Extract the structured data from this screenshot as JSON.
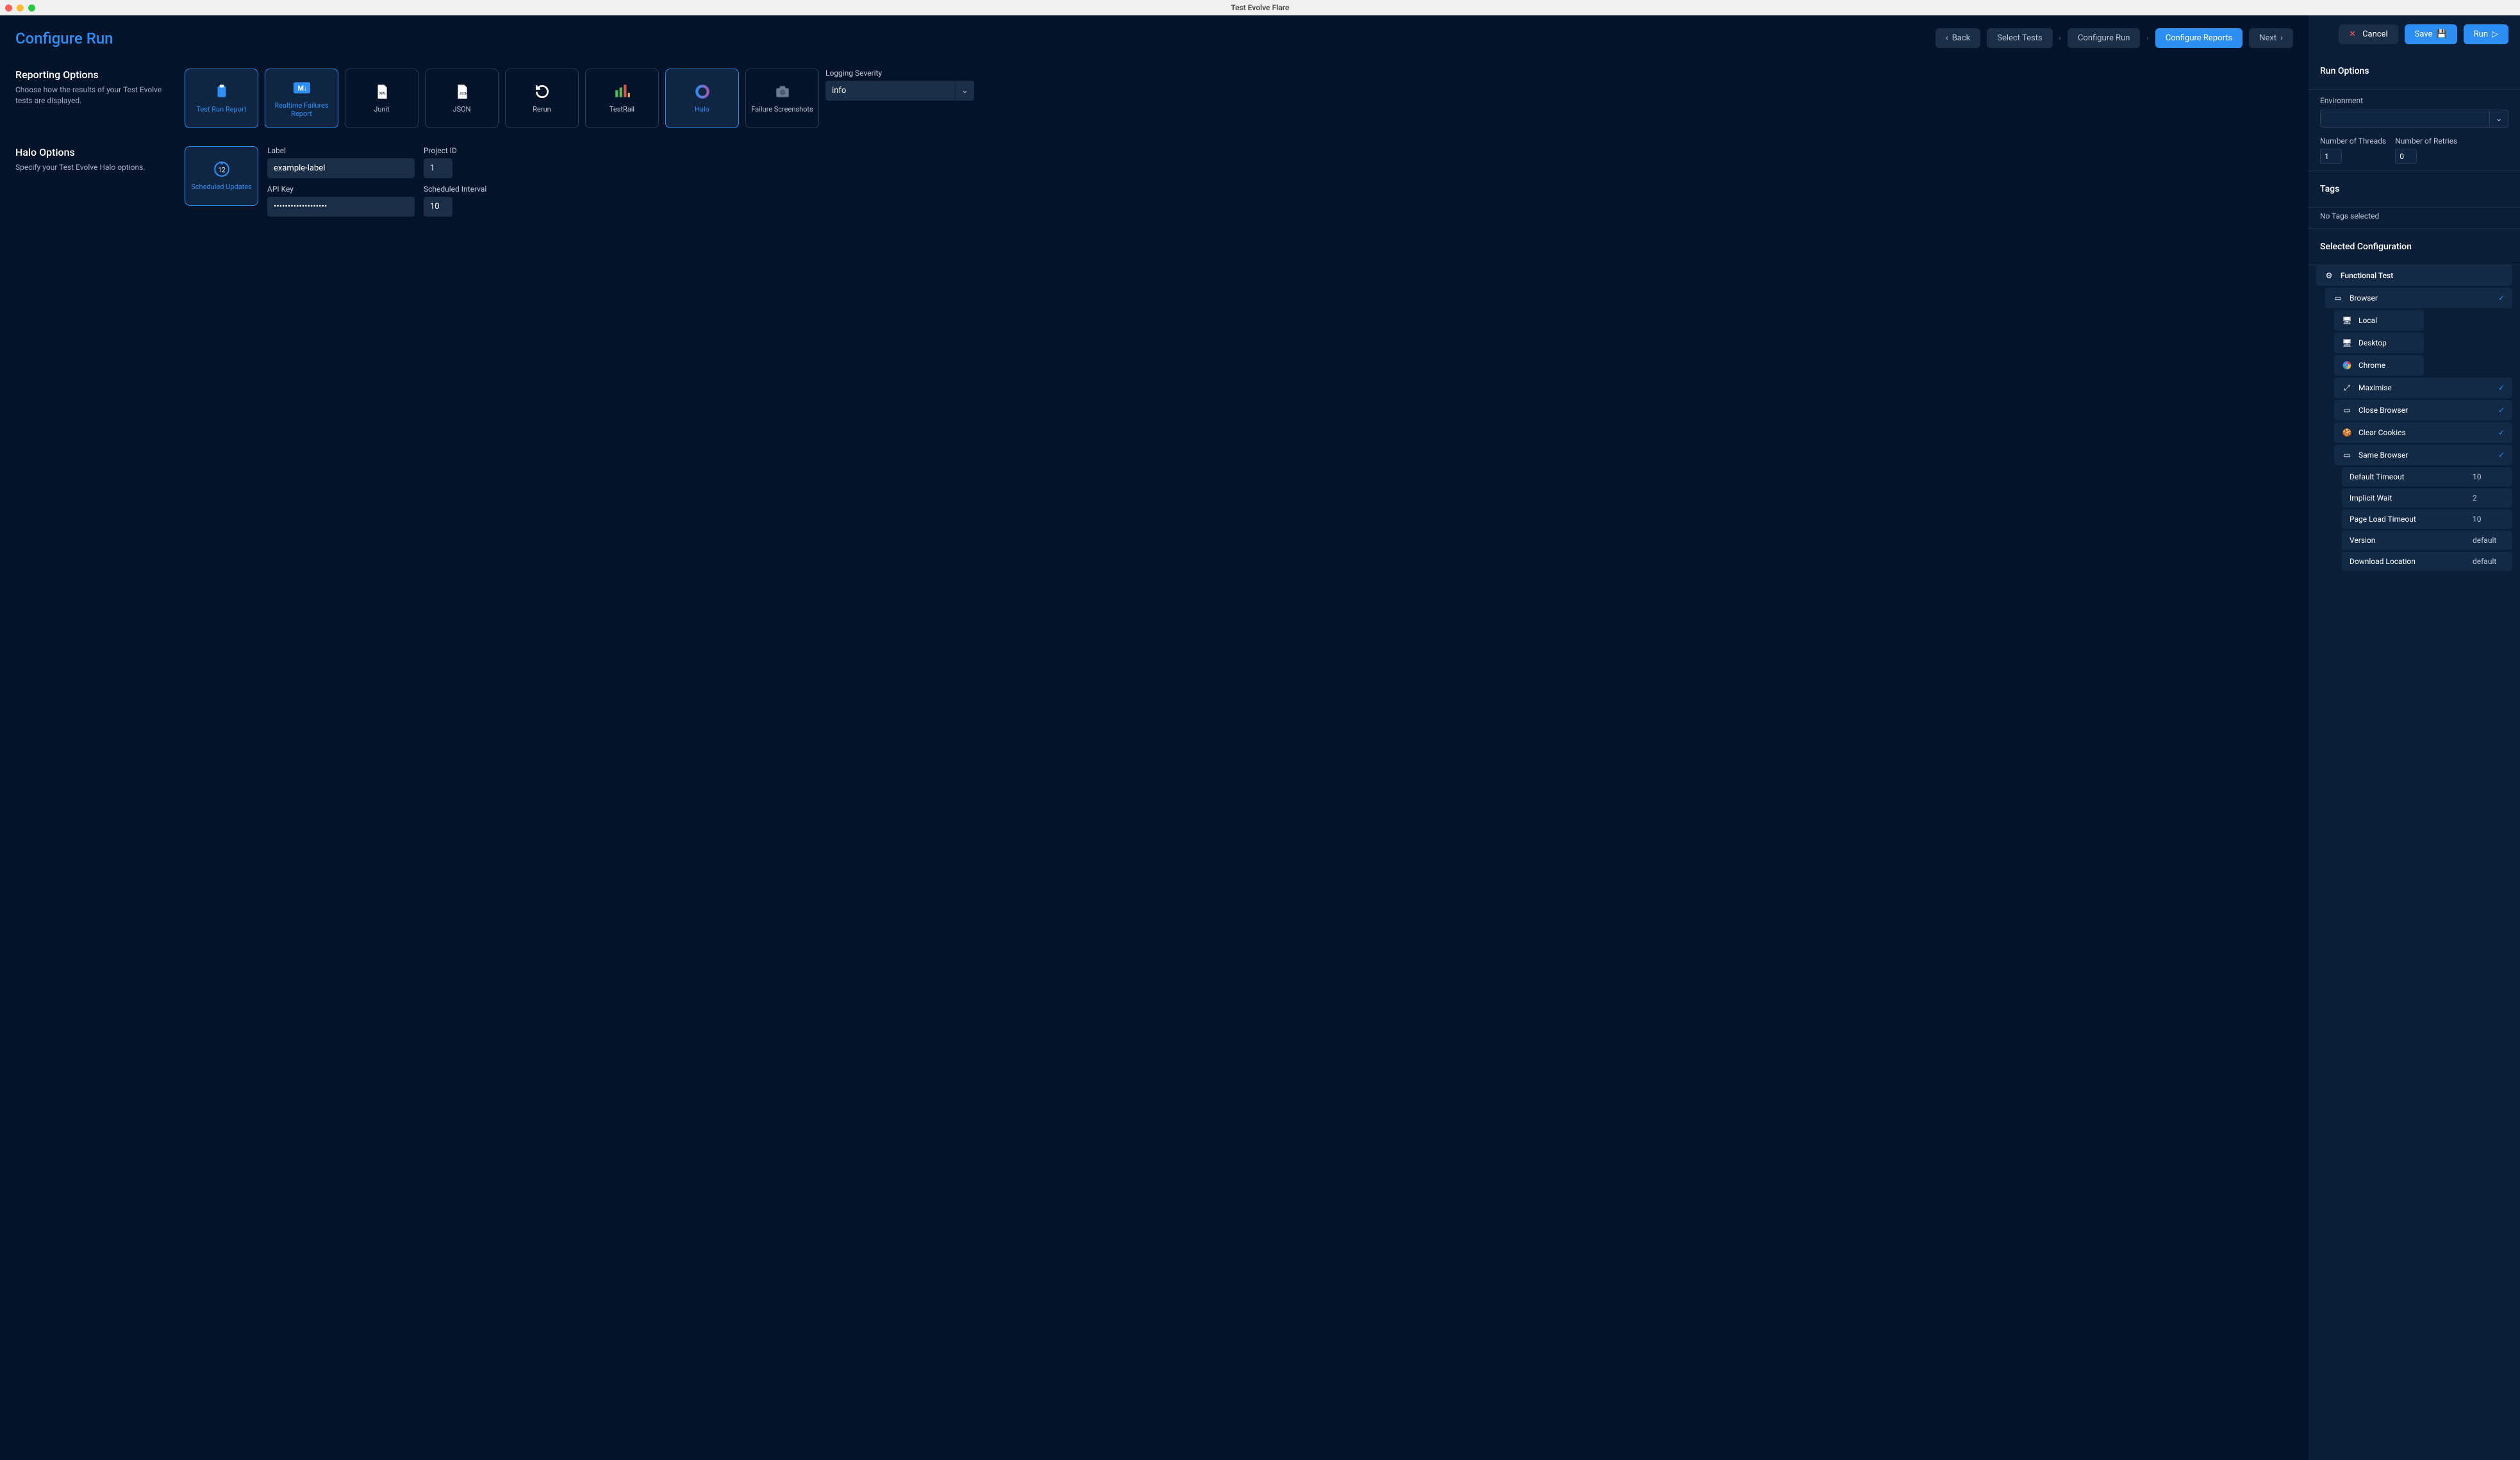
{
  "window_title": "Test Evolve Flare",
  "page_title": "Configure Run",
  "nav": {
    "back": "Back",
    "select_tests": "Select Tests",
    "configure_run": "Configure Run",
    "configure_reports": "Configure Reports",
    "next": "Next"
  },
  "sections": {
    "reporting": {
      "title": "Reporting Options",
      "desc": "Choose how the results of your Test Evolve tests are displayed."
    },
    "halo": {
      "title": "Halo Options",
      "desc": "Specify your Test Evolve Halo options."
    }
  },
  "cards": {
    "test_run_report": "Test Run Report",
    "realtime_failures": "Realtime Failures Report",
    "junit": "Junit",
    "json": "JSON",
    "rerun": "Rerun",
    "testrail": "TestRail",
    "halo": "Halo",
    "failure_screenshots": "Failure Screenshots"
  },
  "logging_severity_label": "Logging Severity",
  "logging_severity_value": "info",
  "halo_card": "Scheduled Updates",
  "halo_form": {
    "label_lbl": "Label",
    "label_val": "example-label",
    "project_lbl": "Project ID",
    "project_val": "1",
    "apikey_lbl": "API Key",
    "apikey_val": "•••••••••••••••••••",
    "interval_lbl": "Scheduled Interval",
    "interval_val": "10"
  },
  "sidebar": {
    "cancel": "Cancel",
    "save": "Save",
    "run": "Run",
    "run_options": "Run Options",
    "environment": "Environment",
    "threads_lbl": "Number of Threads",
    "threads_val": "1",
    "retries_lbl": "Number of Retries",
    "retries_val": "0",
    "tags": "Tags",
    "no_tags": "No Tags selected",
    "selected_config": "Selected Configuration"
  },
  "config": {
    "root": "Functional Test",
    "browser": "Browser",
    "local": "Local",
    "desktop": "Desktop",
    "chrome": "Chrome",
    "maximise": "Maximise",
    "close_browser": "Close Browser",
    "clear_cookies": "Clear Cookies",
    "same_browser": "Same Browser",
    "default_timeout_lbl": "Default Timeout",
    "default_timeout_val": "10",
    "implicit_wait_lbl": "Implicit Wait",
    "implicit_wait_val": "2",
    "page_timeout_lbl": "Page Load Timeout",
    "page_timeout_val": "10",
    "version_lbl": "Version",
    "version_val": "default",
    "download_lbl": "Download Location",
    "download_val": "default"
  }
}
